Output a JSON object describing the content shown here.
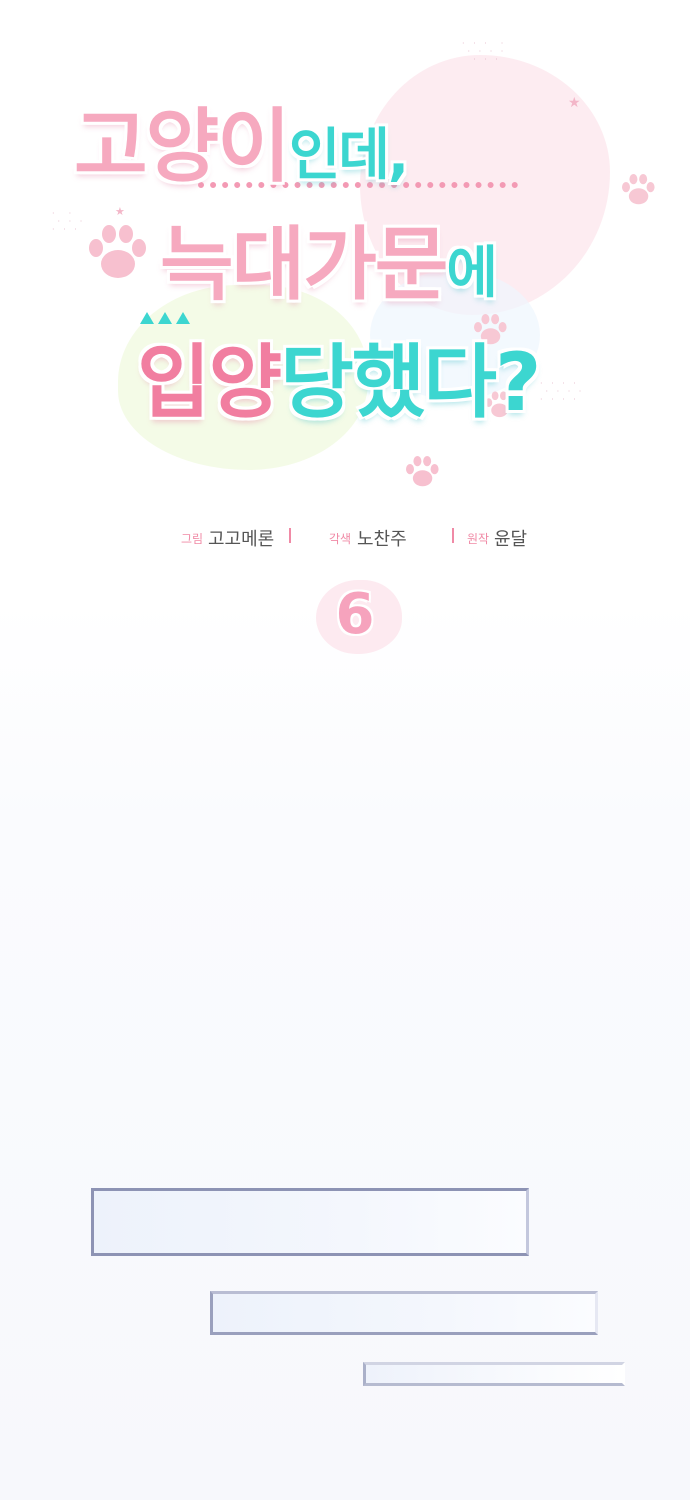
{
  "title": {
    "line1_part1": "고양이",
    "line1_part2": "인데,",
    "line2_part1": "늑대가문",
    "line2_part2": "에",
    "line3_part1": "입양",
    "line3_part2": "당했다?"
  },
  "credits": {
    "art_label": "그림",
    "art_name": "고고메론",
    "adapt_label": "각색",
    "adapt_name": "노찬주",
    "original_label": "원작",
    "original_name": "윤달"
  },
  "episode": {
    "number": "6"
  },
  "colors": {
    "pink": "#f6a9bf",
    "deep_pink": "#f17ea0",
    "teal": "#3cd6d0",
    "bar_border": "#8d93b4"
  },
  "icons": [
    "paw-print-icon",
    "star-icon"
  ]
}
